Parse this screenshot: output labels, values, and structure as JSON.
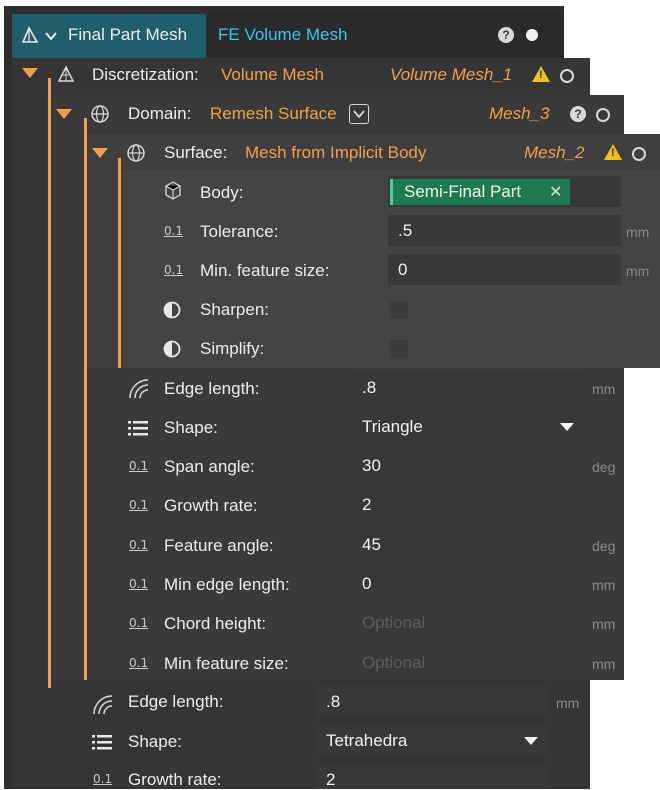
{
  "header": {
    "title": "Final Part Mesh",
    "tab": "FE Volume Mesh"
  },
  "discretization": {
    "label": "Discretization:",
    "value": "Volume Mesh",
    "ref": "Volume Mesh_1"
  },
  "domain": {
    "label": "Domain:",
    "value": "Remesh Surface",
    "ref": "Mesh_3"
  },
  "surface": {
    "label": "Surface:",
    "value": "Mesh from Implicit Body",
    "ref": "Mesh_2",
    "body_label": "Body:",
    "body_value": "Semi-Final Part",
    "tolerance_label": "Tolerance:",
    "tolerance_value": ".5",
    "tolerance_unit": "mm",
    "minfeat_label": "Min. feature size:",
    "minfeat_value": "0",
    "minfeat_unit": "mm",
    "sharpen_label": "Sharpen:",
    "simplify_label": "Simplify:"
  },
  "domain_params": {
    "edge_label": "Edge length:",
    "edge_value": ".8",
    "edge_unit": "mm",
    "shape_label": "Shape:",
    "shape_value": "Triangle",
    "span_label": "Span angle:",
    "span_value": "30",
    "span_unit": "deg",
    "growth_label": "Growth rate:",
    "growth_value": "2",
    "feature_label": "Feature angle:",
    "feature_value": "45",
    "feature_unit": "deg",
    "minedge_label": "Min edge length:",
    "minedge_value": "0",
    "minedge_unit": "mm",
    "chord_label": "Chord height:",
    "chord_placeholder": "Optional",
    "chord_unit": "mm",
    "minfeat_label": "Min feature size:",
    "minfeat_placeholder": "Optional",
    "minfeat_unit": "mm"
  },
  "disc_params": {
    "edge_label": "Edge length:",
    "edge_value": ".8",
    "edge_unit": "mm",
    "shape_label": "Shape:",
    "shape_value": "Tetrahedra",
    "growth_label": "Growth rate:",
    "growth_value": "2"
  },
  "icons": {
    "num_glyph": "0.1"
  },
  "colors": {
    "accent_orange": "#f0a04b",
    "accent_cyan": "#3cc4e8",
    "chip_green": "#1f7a52",
    "warning": "#f2c21a"
  }
}
